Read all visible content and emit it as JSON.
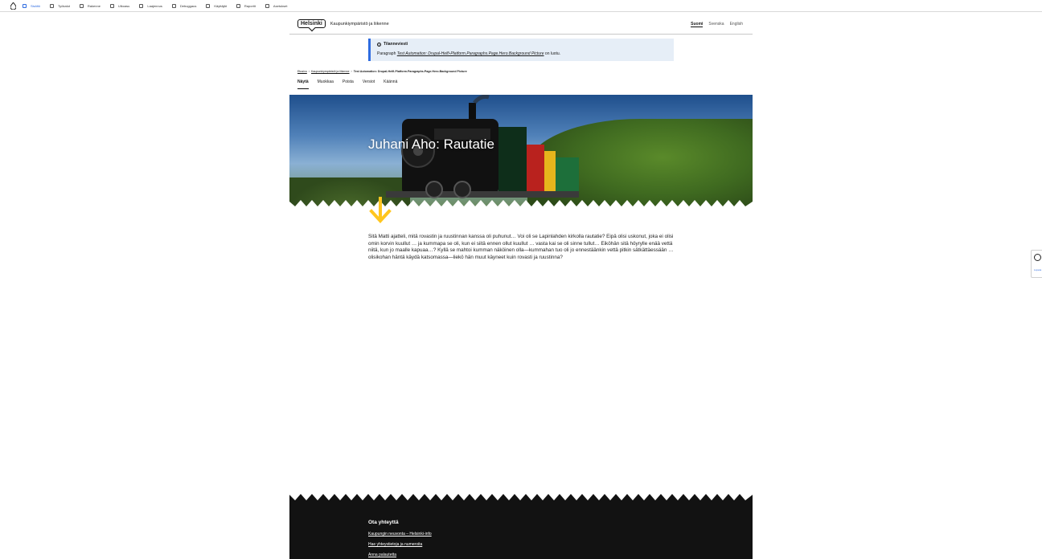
{
  "toolbar": {
    "items": [
      {
        "label": "Sisältö",
        "active": true
      },
      {
        "label": "Työkalut"
      },
      {
        "label": "Rakenne"
      },
      {
        "label": "Ulkoasu"
      },
      {
        "label": "Laajennus"
      },
      {
        "label": "Debuggaus"
      },
      {
        "label": "Käyttäjät"
      },
      {
        "label": "Raportit"
      },
      {
        "label": "Asetukset"
      }
    ]
  },
  "header": {
    "logo": "Helsinki",
    "site_name": "Kaupunkiympäristö ja liikenne",
    "languages": [
      "Suomi",
      "Svenska",
      "English"
    ]
  },
  "status": {
    "title": "Tilanneviesti",
    "prefix": "Paragraph ",
    "item": "Test Automation: Drupal-Helfi-Platform.Paragraphs.Page.Hero.Background Picture",
    "suffix": " on luotu."
  },
  "breadcrumb": [
    "Etusivu",
    "Kaupunkiympäristö ja liikenne",
    "Test Automation: Drupal-Helfi-Platform.Paragraphs.Page.Hero.Background Picture"
  ],
  "tabs": [
    "Näytä",
    "Muokkaa",
    "Poista",
    "Versiot",
    "Käännä"
  ],
  "hero": {
    "title": "Juhani Aho: Rautatie"
  },
  "body_text": "Sitä Matti ajatteli, mitä rovastin ja ruustinnan kanssa oli puhunut… Voi oli se Lapinlahden kirkolla rautatie? Eipä olisi uskonut, joka ei olisi omin korvin kuullut … ja kummapa se oli, kun ei siitä ennen ollut kuullut … vasta kai se oli sinne tullut… Eiköhän sitä höyrylle enää vettä niitä, kun jo maalle kapuaa…? Kyllä se mahtoi kumman näköinen olla—kummahan tuo oli jo ennestäänkin vettä pitkin sätkättäessään … olisikohan häntä käydä katsomassa—liekö hän muut käyneet kuin rovasti ja ruustinna?",
  "side_widget": {
    "label": "Lopeta"
  },
  "footer": {
    "title": "Ota yhteyttä",
    "links": [
      "Kaupungin neuvonta – Helsinki-info",
      "Hae yhteystietoja ja numeroita",
      "Anna palautetta"
    ]
  },
  "colors": {
    "accent": "#2f6ce0",
    "koro_yellow": "#ffc61e",
    "footer_bg": "#121212"
  }
}
